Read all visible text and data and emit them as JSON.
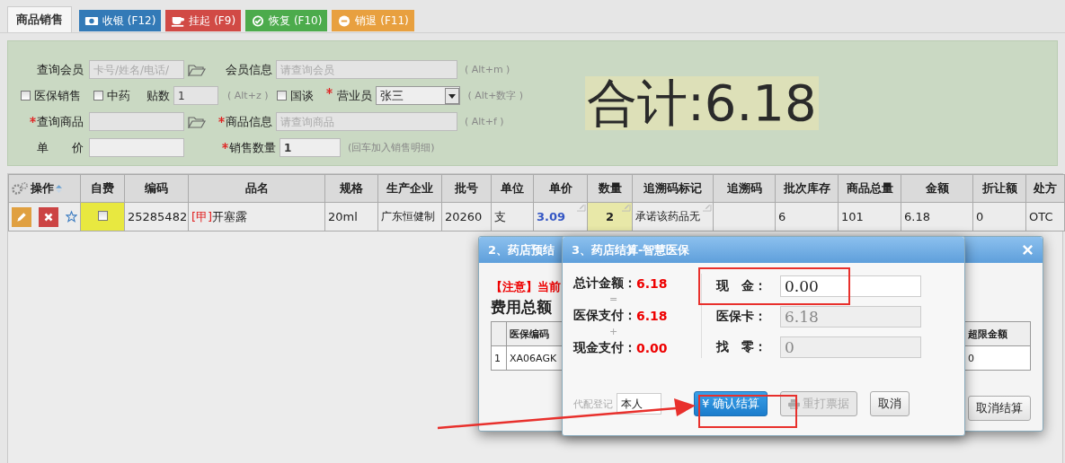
{
  "tabs": [
    {
      "label": "商品销售",
      "selected": true
    }
  ],
  "actions": [
    {
      "kind": "cash",
      "label": "收银 (F12)",
      "color": "#337ab7"
    },
    {
      "kind": "cup",
      "label": "挂起 (F9)",
      "color": "#d14a45"
    },
    {
      "kind": "check",
      "label": "恢复 (F10)",
      "color": "#4cab4c"
    },
    {
      "kind": "minus",
      "label": "销退 (F11)",
      "color": "#e8a03f"
    }
  ],
  "form": {
    "member_search": {
      "label": "查询会员",
      "placeholder": "卡号/姓名/电话/"
    },
    "member_info": {
      "label": "会员信息",
      "placeholder": "请查询会员",
      "hint": "( Alt+m )"
    },
    "insurance_sale": {
      "label": "医保销售",
      "checked": false
    },
    "herbal": {
      "label": "中药",
      "checked": false
    },
    "doses": {
      "label": "贴数",
      "value": "1",
      "hint": "( Alt+z )"
    },
    "national": {
      "label": "国谈",
      "checked": false
    },
    "salesperson": {
      "label": "营业员",
      "required": true,
      "value": "张三",
      "hint": "( Alt+数字 )"
    },
    "product_search": {
      "label": "查询商品",
      "required": true
    },
    "product_info": {
      "label": "商品信息",
      "required": true,
      "placeholder": "请查询商品",
      "hint": "( Alt+f )"
    },
    "unit_price": {
      "label": "单　　价"
    },
    "quantity": {
      "label": "销售数量",
      "required": true,
      "value": "1",
      "hint": "(回车加入销售明细)"
    }
  },
  "total": "合计:6.18",
  "table": {
    "columns": [
      "操作",
      "自费",
      "编码",
      "品名",
      "规格",
      "生产企业",
      "批号",
      "单位",
      "单价",
      "数量",
      "追溯码标记",
      "追溯码",
      "批次库存",
      "商品总量",
      "金额",
      "折让额",
      "处方"
    ],
    "rows": [
      {
        "self_pay": false,
        "code": "25285482",
        "tag": "[甲]",
        "name": "开塞露",
        "spec": "20ml",
        "maker": "广东恒健制",
        "batch": "20260",
        "unit": "支",
        "price": "3.09",
        "qty": "2",
        "trace_flag": "承诺该药品无",
        "batch_stock": "6",
        "total_stock": "101",
        "amount": "6.18",
        "discount": "0",
        "rx": "OTC"
      }
    ]
  },
  "back_dialog": {
    "title": "2、药店预结",
    "notice": "【注意】当前",
    "heading": "费用总额",
    "columns": [
      "医保编码",
      "超限金额"
    ],
    "rows": [
      {
        "index": "1",
        "code": "XA06AGK",
        "over": "0"
      }
    ],
    "cancel_button": "取消结算"
  },
  "front_dialog": {
    "title": "3、药店结算-智慧医保",
    "summary": [
      {
        "label": "总计金额：",
        "value": "6.18"
      },
      {
        "label": "医保支付：",
        "value": "6.18"
      },
      {
        "label": "现金支付：",
        "value": "0.00"
      }
    ],
    "operators": [
      "=",
      "+"
    ],
    "payments": [
      {
        "label": "现　金：",
        "value": "0.00",
        "disabled": false
      },
      {
        "label": "医保卡：",
        "value": "6.18",
        "disabled": true
      },
      {
        "label": "找　零：",
        "value": "0",
        "disabled": true
      }
    ],
    "proxy_label": "代配登记",
    "proxy_value": "本人",
    "buttons": [
      {
        "kind": "primary",
        "label": "¥ 确认结算",
        "disabled": false
      },
      {
        "kind": "print",
        "label": "重打票据",
        "disabled": true
      },
      {
        "kind": "default",
        "label": "取消",
        "disabled": false
      }
    ]
  }
}
